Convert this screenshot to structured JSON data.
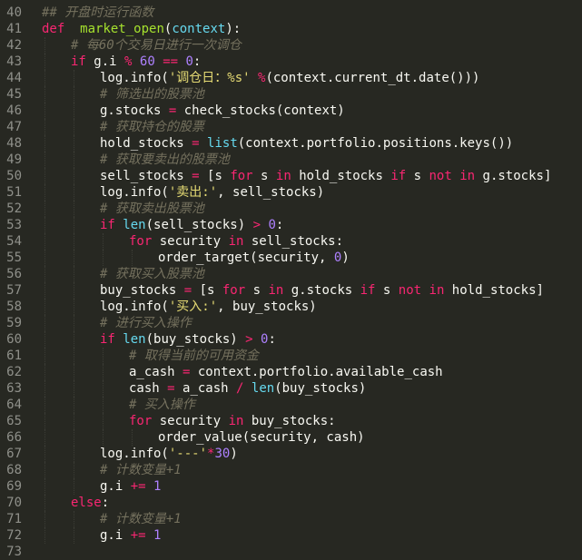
{
  "editor": {
    "lines": [
      {
        "n": "40",
        "indent": 0,
        "tokens": [
          [
            "cm",
            "## 开盘时运行函数"
          ]
        ]
      },
      {
        "n": "41",
        "indent": 0,
        "tokens": [
          [
            "kw",
            "def"
          ],
          [
            "",
            "  "
          ],
          [
            "fn",
            "market_open"
          ],
          [
            "",
            "("
          ],
          [
            "builtin",
            "context"
          ],
          [
            "",
            "):"
          ]
        ]
      },
      {
        "n": "42",
        "indent": 1,
        "tokens": [
          [
            "cm",
            "# 每60个交易日进行一次调仓"
          ]
        ]
      },
      {
        "n": "43",
        "indent": 1,
        "tokens": [
          [
            "kw",
            "if"
          ],
          [
            "",
            " g.i "
          ],
          [
            "kw",
            "%"
          ],
          [
            "",
            " "
          ],
          [
            "num",
            "60"
          ],
          [
            "",
            " "
          ],
          [
            "kw",
            "=="
          ],
          [
            "",
            " "
          ],
          [
            "num",
            "0"
          ],
          [
            "",
            ":"
          ]
        ]
      },
      {
        "n": "44",
        "indent": 2,
        "tokens": [
          [
            "",
            "log.info("
          ],
          [
            "str",
            "'调仓日：%s'"
          ],
          [
            "",
            " "
          ],
          [
            "kw",
            "%"
          ],
          [
            "",
            "(context.current_dt.date()))"
          ]
        ]
      },
      {
        "n": "45",
        "indent": 2,
        "tokens": [
          [
            "cm",
            "# 筛选出的股票池"
          ]
        ]
      },
      {
        "n": "46",
        "indent": 2,
        "tokens": [
          [
            "",
            "g.stocks "
          ],
          [
            "kw",
            "="
          ],
          [
            "",
            " check_stocks(context)"
          ]
        ]
      },
      {
        "n": "47",
        "indent": 2,
        "tokens": [
          [
            "cm",
            "# 获取持仓的股票"
          ]
        ]
      },
      {
        "n": "48",
        "indent": 2,
        "tokens": [
          [
            "",
            "hold_stocks "
          ],
          [
            "kw",
            "="
          ],
          [
            "",
            " "
          ],
          [
            "builtin",
            "list"
          ],
          [
            "",
            "(context.portfolio.positions.keys())"
          ]
        ]
      },
      {
        "n": "49",
        "indent": 2,
        "tokens": [
          [
            "cm",
            "# 获取要卖出的股票池"
          ]
        ]
      },
      {
        "n": "50",
        "indent": 2,
        "tokens": [
          [
            "",
            "sell_stocks "
          ],
          [
            "kw",
            "="
          ],
          [
            "",
            " [s "
          ],
          [
            "kw",
            "for"
          ],
          [
            "",
            " s "
          ],
          [
            "kw",
            "in"
          ],
          [
            "",
            " hold_stocks "
          ],
          [
            "kw",
            "if"
          ],
          [
            "",
            " s "
          ],
          [
            "kw",
            "not"
          ],
          [
            "",
            " "
          ],
          [
            "kw",
            "in"
          ],
          [
            "",
            " g.stocks]"
          ]
        ]
      },
      {
        "n": "51",
        "indent": 2,
        "tokens": [
          [
            "",
            "log.info("
          ],
          [
            "str",
            "'卖出:'"
          ],
          [
            "",
            ", sell_stocks)"
          ]
        ]
      },
      {
        "n": "52",
        "indent": 2,
        "tokens": [
          [
            "cm",
            "# 获取卖出股票池"
          ]
        ]
      },
      {
        "n": "53",
        "indent": 2,
        "tokens": [
          [
            "kw",
            "if"
          ],
          [
            "",
            " "
          ],
          [
            "builtin",
            "len"
          ],
          [
            "",
            "(sell_stocks) "
          ],
          [
            "kw",
            ">"
          ],
          [
            "",
            " "
          ],
          [
            "num",
            "0"
          ],
          [
            "",
            ":"
          ]
        ]
      },
      {
        "n": "54",
        "indent": 3,
        "tokens": [
          [
            "kw",
            "for"
          ],
          [
            "",
            " security "
          ],
          [
            "kw",
            "in"
          ],
          [
            "",
            " sell_stocks:"
          ]
        ]
      },
      {
        "n": "55",
        "indent": 4,
        "tokens": [
          [
            "",
            "order_target(security, "
          ],
          [
            "num",
            "0"
          ],
          [
            "",
            ")"
          ]
        ]
      },
      {
        "n": "56",
        "indent": 2,
        "tokens": [
          [
            "cm",
            "# 获取买入股票池"
          ]
        ]
      },
      {
        "n": "57",
        "indent": 2,
        "tokens": [
          [
            "",
            "buy_stocks "
          ],
          [
            "kw",
            "="
          ],
          [
            "",
            " [s "
          ],
          [
            "kw",
            "for"
          ],
          [
            "",
            " s "
          ],
          [
            "kw",
            "in"
          ],
          [
            "",
            " g.stocks "
          ],
          [
            "kw",
            "if"
          ],
          [
            "",
            " s "
          ],
          [
            "kw",
            "not"
          ],
          [
            "",
            " "
          ],
          [
            "kw",
            "in"
          ],
          [
            "",
            " hold_stocks]"
          ]
        ]
      },
      {
        "n": "58",
        "indent": 2,
        "tokens": [
          [
            "",
            "log.info("
          ],
          [
            "str",
            "'买入:'"
          ],
          [
            "",
            ", buy_stocks)"
          ]
        ]
      },
      {
        "n": "59",
        "indent": 2,
        "tokens": [
          [
            "cm",
            "# 进行买入操作"
          ]
        ]
      },
      {
        "n": "60",
        "indent": 2,
        "tokens": [
          [
            "kw",
            "if"
          ],
          [
            "",
            " "
          ],
          [
            "builtin",
            "len"
          ],
          [
            "",
            "(buy_stocks) "
          ],
          [
            "kw",
            ">"
          ],
          [
            "",
            " "
          ],
          [
            "num",
            "0"
          ],
          [
            "",
            ":"
          ]
        ]
      },
      {
        "n": "61",
        "indent": 3,
        "tokens": [
          [
            "cm",
            "# 取得当前的可用资金"
          ]
        ]
      },
      {
        "n": "62",
        "indent": 3,
        "tokens": [
          [
            "",
            "a_cash "
          ],
          [
            "kw",
            "="
          ],
          [
            "",
            " context.portfolio.available_cash"
          ]
        ]
      },
      {
        "n": "63",
        "indent": 3,
        "tokens": [
          [
            "",
            "cash "
          ],
          [
            "kw",
            "="
          ],
          [
            "",
            " a_cash "
          ],
          [
            "kw",
            "/"
          ],
          [
            "",
            " "
          ],
          [
            "builtin",
            "len"
          ],
          [
            "",
            "(buy_stocks)"
          ]
        ]
      },
      {
        "n": "64",
        "indent": 3,
        "tokens": [
          [
            "cm",
            "# 买入操作"
          ]
        ]
      },
      {
        "n": "65",
        "indent": 3,
        "tokens": [
          [
            "kw",
            "for"
          ],
          [
            "",
            " security "
          ],
          [
            "kw",
            "in"
          ],
          [
            "",
            " buy_stocks:"
          ]
        ]
      },
      {
        "n": "66",
        "indent": 4,
        "tokens": [
          [
            "",
            "order_value(security, cash)"
          ]
        ]
      },
      {
        "n": "67",
        "indent": 2,
        "tokens": [
          [
            "",
            "log.info("
          ],
          [
            "str",
            "'---'"
          ],
          [
            "kw",
            "*"
          ],
          [
            "num",
            "30"
          ],
          [
            "",
            ")"
          ]
        ]
      },
      {
        "n": "68",
        "indent": 2,
        "tokens": [
          [
            "cm",
            "# 计数变量+1"
          ]
        ]
      },
      {
        "n": "69",
        "indent": 2,
        "tokens": [
          [
            "",
            "g.i "
          ],
          [
            "kw",
            "+="
          ],
          [
            "",
            " "
          ],
          [
            "num",
            "1"
          ]
        ]
      },
      {
        "n": "70",
        "indent": 1,
        "tokens": [
          [
            "kw",
            "else"
          ],
          [
            "",
            ":"
          ]
        ]
      },
      {
        "n": "71",
        "indent": 2,
        "tokens": [
          [
            "cm",
            "# 计数变量+1"
          ]
        ]
      },
      {
        "n": "72",
        "indent": 2,
        "tokens": [
          [
            "",
            "g.i "
          ],
          [
            "kw",
            "+="
          ],
          [
            "",
            " "
          ],
          [
            "num",
            "1"
          ]
        ]
      },
      {
        "n": "73",
        "indent": 0,
        "tokens": []
      }
    ]
  }
}
